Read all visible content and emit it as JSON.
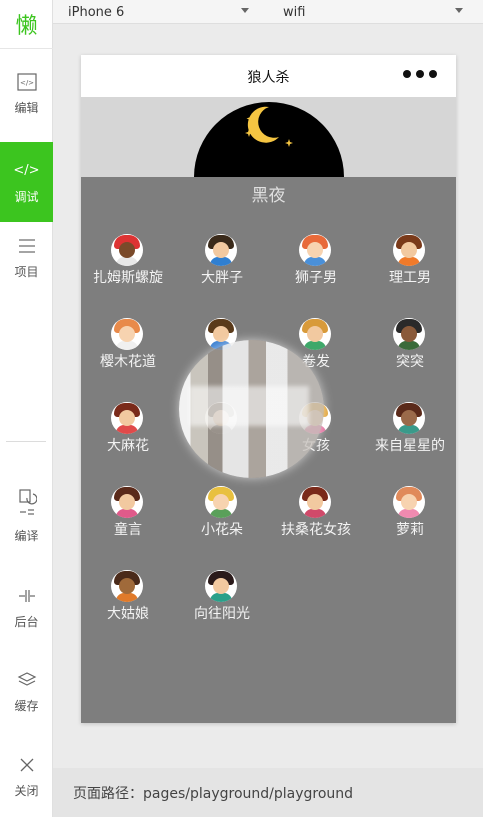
{
  "sidebar": {
    "logo": "懒",
    "items": [
      {
        "label": "编辑",
        "icon": "code-file-icon"
      },
      {
        "label": "调试",
        "icon": "debug-icon"
      },
      {
        "label": "项目",
        "icon": "menu-lines-icon"
      },
      {
        "label": "编译",
        "icon": "compile-icon"
      },
      {
        "label": "后台",
        "icon": "background-icon"
      },
      {
        "label": "缓存",
        "icon": "layers-icon"
      },
      {
        "label": "关闭",
        "icon": "close-icon"
      }
    ]
  },
  "toolbar": {
    "device": "iPhone 6",
    "network": "wifi"
  },
  "phone": {
    "nav_title": "狼人杀",
    "night_label": "黑夜",
    "players": [
      {
        "name": "扎姆斯螺旋",
        "hair": "#d33",
        "face": "#7a4a2a",
        "shirt": "#e8e8e8"
      },
      {
        "name": "大胖子",
        "hair": "#3a2a1a",
        "face": "#f2c9a0",
        "shirt": "#2f7fd1"
      },
      {
        "name": "狮子男",
        "hair": "#e86a3a",
        "face": "#f7d3b0",
        "shirt": "#4a90d9"
      },
      {
        "name": "理工男",
        "hair": "#7a3a1a",
        "face": "#f2c9a0",
        "shirt": "#f07a2a"
      },
      {
        "name": "樱木花道",
        "hair": "#e88a4a",
        "face": "#f7d3b0",
        "shirt": "#f0f0f0"
      },
      {
        "name": "",
        "hair": "#5a3a1a",
        "face": "#f2c9a0",
        "shirt": "#3a7fd1"
      },
      {
        "name": "卷发",
        "hair": "#d89a3a",
        "face": "#f2c9a0",
        "shirt": "#3fa86a"
      },
      {
        "name": "突突",
        "hair": "#2a2a2a",
        "face": "#8a5a3a",
        "shirt": "#3a6a3a"
      },
      {
        "name": "大麻花",
        "hair": "#7a2a1a",
        "face": "#f2c9a0",
        "shirt": "#e04a4a"
      },
      {
        "name": "",
        "hair": "#3a2a1a",
        "face": "#f2c9a0",
        "shirt": "#888"
      },
      {
        "name": "女孩",
        "hair": "#e0a030",
        "face": "#f2c9a0",
        "shirt": "#e06a9a"
      },
      {
        "name": "来自星星的",
        "hair": "#5a2a1a",
        "face": "#9a6a4a",
        "shirt": "#3a9a8a"
      },
      {
        "name": "童言",
        "hair": "#5a2a1a",
        "face": "#f2c9a0",
        "shirt": "#e05a8a"
      },
      {
        "name": "小花朵",
        "hair": "#e8c040",
        "face": "#f7d3b0",
        "shirt": "#5aa05a"
      },
      {
        "name": "扶桑花女孩",
        "hair": "#7a2a1a",
        "face": "#f2c9a0",
        "shirt": "#d04a6a"
      },
      {
        "name": "萝莉",
        "hair": "#e08a5a",
        "face": "#f7d3b0",
        "shirt": "#f08ab0"
      },
      {
        "name": "大姑娘",
        "hair": "#4a2a1a",
        "face": "#a06a3a",
        "shirt": "#e07a2a"
      },
      {
        "name": "向往阳光",
        "hair": "#2a1a1a",
        "face": "#f2c9a0",
        "shirt": "#2aa08a"
      }
    ]
  },
  "footer": {
    "path_label": "页面路径：pages/playground/playground"
  },
  "colors": {
    "accent": "#3cc51f",
    "night_bg": "#7e7e7e",
    "hero_bg": "#d6d6d6"
  }
}
